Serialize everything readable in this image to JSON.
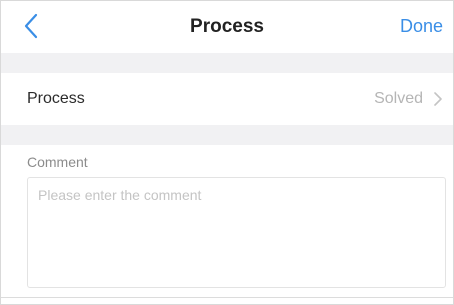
{
  "header": {
    "back_icon": "chevron-left-icon",
    "title": "Process",
    "done_label": "Done",
    "accent_color": "#3a8ee6"
  },
  "process_row": {
    "label": "Process",
    "value": "Solved",
    "chevron_icon": "chevron-right-icon"
  },
  "comment": {
    "label": "Comment",
    "placeholder": "Please enter the comment",
    "value": ""
  }
}
